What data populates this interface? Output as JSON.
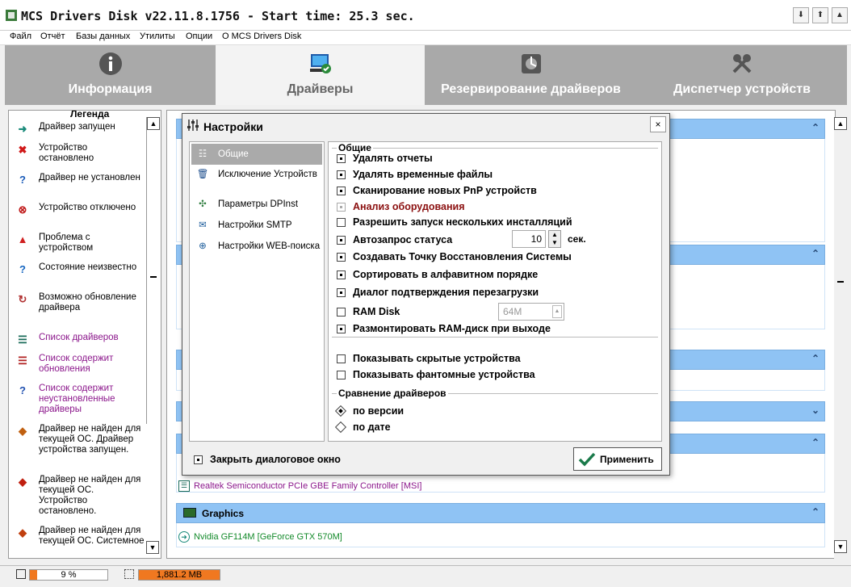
{
  "window": {
    "title": "MCS Drivers Disk v22.11.8.1756 - Start time: 25.3 sec.",
    "buttons": [
      "⬇",
      "⬆",
      "▲"
    ]
  },
  "menu": [
    "Файл",
    "Отчёт",
    "Базы данных",
    "Утилиты",
    "Опции",
    "О MCS Drivers Disk"
  ],
  "tabs": [
    {
      "label": "Информация",
      "icon": "info-icon"
    },
    {
      "label": "Драйверы",
      "icon": "drivers-icon"
    },
    {
      "label": "Резервирование драйверов",
      "icon": "backup-icon"
    },
    {
      "label": "Диспетчер устройств",
      "icon": "tools-icon"
    }
  ],
  "legend": {
    "title": "Легенда",
    "items": [
      {
        "text": "Драйвер запущен",
        "icon": "running-icon",
        "glyph": "➜",
        "color": "#1a8a7a"
      },
      {
        "text": "Устройство остановлено",
        "icon": "stopped-icon",
        "glyph": "✖",
        "color": "#d01818"
      },
      {
        "text": "Драйвер не установлен",
        "icon": "question-icon",
        "glyph": "?",
        "color": "#1a5bb8"
      },
      {
        "text": "Устройство отключено",
        "icon": "disabled-icon",
        "glyph": "⊗",
        "color": "#c01818"
      },
      {
        "text": "Проблема с устройством",
        "icon": "warning-icon",
        "glyph": "▲",
        "color": "#d02020"
      },
      {
        "text": "Состояние неизвестно",
        "icon": "unknown-icon",
        "glyph": "?",
        "color": "#1565c0"
      },
      {
        "text": "Возможно обновление драйвера",
        "icon": "update-icon",
        "glyph": "↻",
        "color": "#b03030"
      },
      {
        "text": "Список драйверов",
        "icon": "list-icon",
        "glyph": "☰",
        "color": "#1a6b5a"
      },
      {
        "text": "Список содержит обновления",
        "icon": "list-update-icon",
        "glyph": "☰",
        "color": "#b02020"
      },
      {
        "text": "Список содержит неустановленные драйверы",
        "icon": "list-missing-icon",
        "glyph": "?",
        "color": "#2050b0"
      },
      {
        "text": "Драйвер не найден для текущей ОС. Драйвер устройства запущен.",
        "icon": "no-driver-running-icon",
        "glyph": "◆",
        "color": "#c06010"
      },
      {
        "text": "Драйвер не найден для текущей ОС. Устройство остановлено.",
        "icon": "no-driver-stopped-icon",
        "glyph": "◆",
        "color": "#c02010"
      },
      {
        "text": "Драйвер не найден для текущей ОС. Системное",
        "icon": "no-driver-system-icon",
        "glyph": "◆",
        "color": "#c04010"
      }
    ]
  },
  "groups": [
    {
      "name": "",
      "chevron": "⌃"
    },
    {
      "name": "",
      "chevron": "⌃"
    },
    {
      "name": "",
      "chevron": "⌃"
    },
    {
      "name": "",
      "chevron": "⌄"
    },
    {
      "name": "",
      "chevron": "⌃"
    },
    {
      "name": "Graphics",
      "chevron": "⌃"
    }
  ],
  "drivers": [
    {
      "text": "Realtek Semiconductor PCIe GBE Family Controller [MSI]",
      "color": "#8b168b"
    },
    {
      "text": "Nvidia GF114M [GeForce GTX 570M]",
      "color": "#138a2a"
    }
  ],
  "status": {
    "cpu": "9 %",
    "cpu_fraction": 0.09,
    "memory": "1,881.2 MB",
    "mem_fraction": 1.0
  },
  "dialog": {
    "title": "Настройки",
    "close": "×",
    "nav": [
      {
        "label": "Общие",
        "icon": "sliders-icon",
        "selected": true
      },
      {
        "label": "Исключение Устройств",
        "icon": "trash-icon"
      },
      {
        "label": "Параметры DPInst",
        "icon": "puzzle-icon"
      },
      {
        "label": "Настройки SMTP",
        "icon": "mail-globe-icon"
      },
      {
        "label": "Настройки WEB-поиска",
        "icon": "web-search-icon"
      }
    ],
    "section_general": "Общие",
    "options": [
      {
        "label": "Удалять отчеты",
        "checked": true
      },
      {
        "label": "Удалять временные файлы",
        "checked": true
      },
      {
        "label": "Сканирование новых PnP устройств",
        "checked": true
      },
      {
        "label": "Анализ оборудования",
        "checked": true,
        "disabled": true
      },
      {
        "label": "Разрешить запуск нескольких инсталляций",
        "checked": false
      },
      {
        "label": "Автозапрос статуса",
        "checked": true
      },
      {
        "label": "Создавать Точку Восстановления Системы",
        "checked": true
      },
      {
        "label": "Сортировать в алфавитном порядке",
        "checked": true
      },
      {
        "label": "Диалог подтверждения перезагрузки",
        "checked": true
      },
      {
        "label": "RAM Disk",
        "checked": false
      },
      {
        "label": "Размонтировать RAM-диск при выходе",
        "checked": true
      }
    ],
    "status_interval": "10",
    "status_unit": "сек.",
    "ram_size": "64M",
    "options2": [
      {
        "label": "Показывать скрытые устройства",
        "checked": false
      },
      {
        "label": "Показывать фантомные устройства",
        "checked": false
      }
    ],
    "section_compare": "Сравнение драйверов",
    "radios": [
      {
        "label": "по версии",
        "selected": true
      },
      {
        "label": "по дате",
        "selected": false
      }
    ],
    "close_dialog_label": "Закрыть диалоговое окно",
    "apply_label": "Применить"
  }
}
